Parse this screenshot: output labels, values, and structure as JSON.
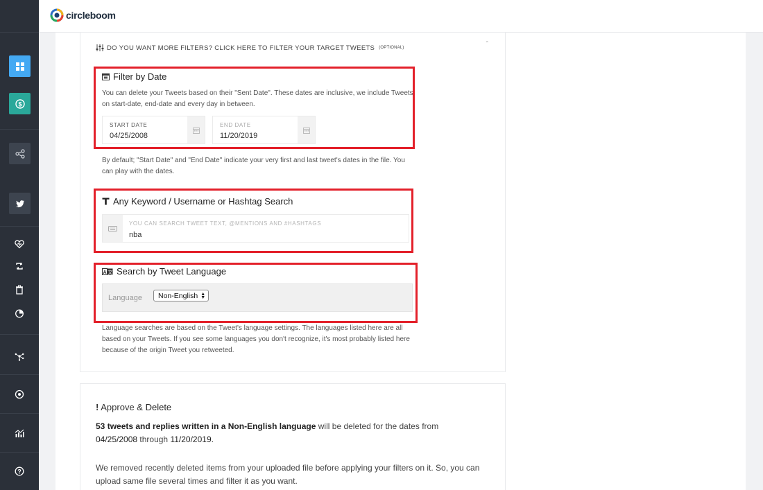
{
  "brand": {
    "name": "circleboom"
  },
  "sidebar": {
    "icons": [
      "dashboard-icon",
      "dollar-icon",
      "share-icon",
      "twitter-icon",
      "heart-icon",
      "retweet-icon",
      "trash-icon",
      "archive-icon",
      "network-icon",
      "circle-icon",
      "chart-icon",
      "help-icon"
    ]
  },
  "filters": {
    "heading": "DO YOU WANT MORE FILTERS? CLICK HERE TO FILTER YOUR TARGET TWEETS",
    "heading_optional": "(OPTIONAL)",
    "date": {
      "title": "Filter by Date",
      "description": "You can delete your Tweets based on their \"Sent Date\". These dates are inclusive, we include Tweets on start-date, end-date and every day in between.",
      "start_label": "START DATE",
      "start_value": "04/25/2008",
      "end_label": "END DATE",
      "end_value": "11/20/2019",
      "note": "By default; \"Start Date\" and \"End Date\" indicate your very first and last tweet's dates in the file. You can play with the dates."
    },
    "keyword": {
      "title": "Any Keyword / Username or Hashtag Search",
      "placeholder": "YOU CAN SEARCH TWEET TEXT, @MENTIONS AND #HASHTAGS",
      "value": "nba"
    },
    "language": {
      "title": "Search by Tweet Language",
      "label": "Language",
      "selected": "Non-English",
      "note": "Language searches are based on the Tweet's language settings. The languages listed here are all based on your Tweets. If you see some languages you don't recognize, it's most probably listed here because of the origin Tweet you retweeted."
    }
  },
  "approve": {
    "title_a": "Approve &",
    "title_b": "Delete",
    "count": "53",
    "line1_bold": "tweets and replies written in a Non-English language",
    "line1_rest": "will be deleted for the dates from",
    "from_date": "04/25/2008",
    "through": "through",
    "to_date": "11/20/2019.",
    "note": "We removed recently deleted items from your uploaded file before applying your filters on it. So, you can upload same file several times and filter it as you want."
  },
  "colors": {
    "highlight": "#e3202a",
    "accent_blue": "#44a9f3",
    "accent_teal": "#2aa89a",
    "sidebar": "#2b3039"
  }
}
